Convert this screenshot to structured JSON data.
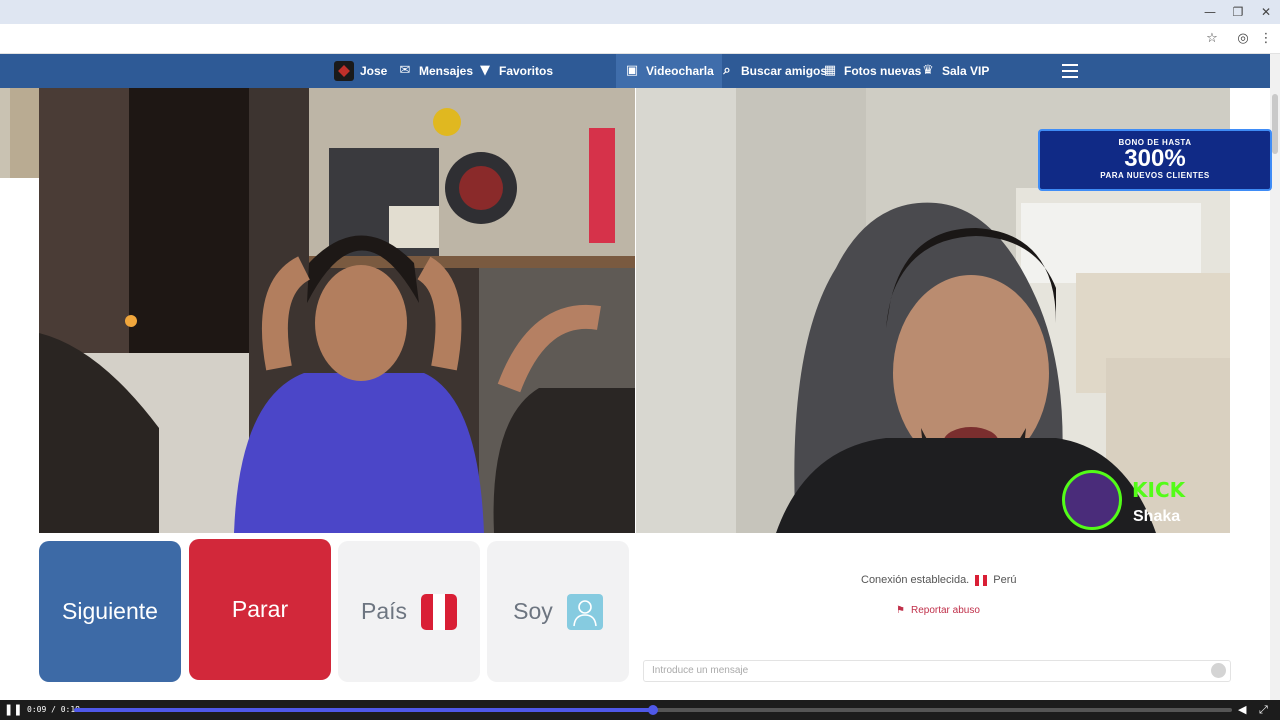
{
  "window_controls": [
    "—",
    "❐",
    "✕"
  ],
  "nav": {
    "user": "Jose",
    "messages": "Mensajes",
    "favorites": "Favoritos",
    "videochat": "Videocharla",
    "find_friends": "Buscar amigos",
    "new_photos": "Fotos nuevas",
    "vip": "Sala VIP"
  },
  "overlay": {
    "promo_line1": "BONO DE HASTA",
    "promo_big": "300%",
    "promo_line2": "PARA NUEVOS CLIENTES",
    "kick_logo": "KICK",
    "streamer": "Shaka"
  },
  "controls": {
    "next": "Siguiente",
    "stop": "Parar",
    "country": "País",
    "gender": "Soy"
  },
  "chat": {
    "status": "Conexión establecida.",
    "country": "Perú",
    "report": "Reportar abuso",
    "placeholder": "Introduce un mensaje"
  },
  "player": {
    "time": "0:09 / 0:18",
    "progress": 0.5
  },
  "colors": {
    "nav_bg": "#2e5a96",
    "next_btn": "#3d6aa6",
    "stop_btn": "#d2283a",
    "flag_red": "#d91f35",
    "progress": "#4f58e8"
  }
}
